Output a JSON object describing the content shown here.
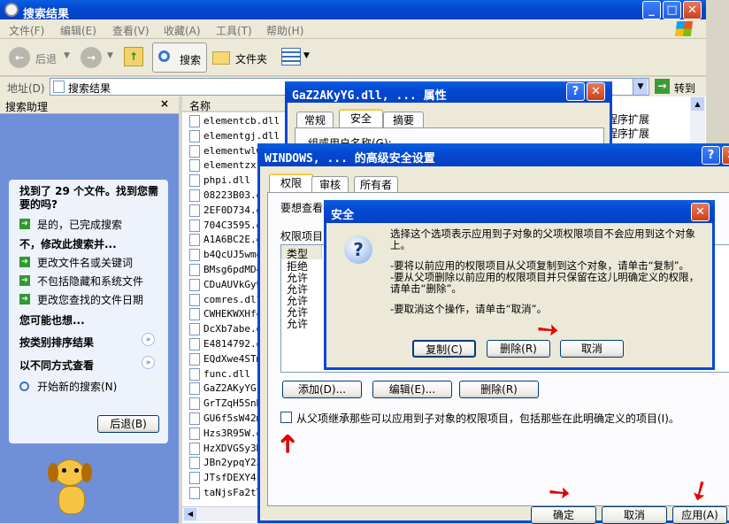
{
  "explorer": {
    "title": "搜索结果",
    "menu": [
      "文件(F)",
      "编辑(E)",
      "查看(V)",
      "收藏(A)",
      "工具(T)",
      "帮助(H)"
    ],
    "toolbar": {
      "back": "后退",
      "search": "搜索",
      "folders": "文件夹"
    },
    "address_label": "地址(D)",
    "address_value": "搜索结果",
    "go": "转到",
    "column_name": "名称",
    "right_items": [
      "程序扩展",
      "程序扩展"
    ],
    "files": [
      "elementcb.dll",
      "elementgj.dll",
      "elementwlw",
      "elementzx.d",
      "phpi.dll",
      "08223B03.d",
      "2EF0D734.d",
      "704C3595.d",
      "A1A6BC2E.d",
      "b4QcUJ5wmq",
      "BMsg6pdMD4",
      "CDuAUVkGy9",
      "comres.dll",
      "CWHEKWXHf4",
      "DcXb7abe.d",
      "E4814792.d",
      "EQdXwe4STm",
      "func.dll",
      "GaZ2AKyYG.d",
      "GrTZqH5SnR",
      "GU6f5sW42m",
      "Hzs3R95W.d",
      "HzXDVGSy3D",
      "JBn2ypqY23",
      "JTsfDEXY4s",
      "taNjsFa2tT"
    ]
  },
  "assistant": {
    "title": "搜索助理",
    "found": "找到了 29 个文件。找到您需要的吗?",
    "yes": "是的，已完成搜索",
    "no_heading": "不，修改此搜索并...",
    "opt1": "更改文件名或关键词",
    "opt2": "不包括隐藏和系统文件",
    "opt3": "更改您查找的文件日期",
    "maybe": "您可能也想...",
    "sort": "按类别排序结果",
    "view": "以不同方式查看",
    "new_search": "开始新的搜索(N)",
    "back": "后退(B)"
  },
  "props": {
    "title": "GaZ2AKyYG.dll, ... 属性",
    "tabs": [
      "常规",
      "安全",
      "摘要"
    ],
    "group_label": "组或用户名称(G):"
  },
  "advanced": {
    "title": "WINDOWS, ... 的高级安全设置",
    "tabs": [
      "权限",
      "审核",
      "所有者"
    ],
    "intro": "要想查看有",
    "perm_label": "权限项目",
    "type_header": "类型",
    "types": [
      "拒绝",
      "允许",
      "允许",
      "允许",
      "允许",
      "允许"
    ],
    "add": "添加(D)...",
    "edit": "编辑(E)...",
    "remove": "删除(R)",
    "inherit": "从父项继承那些可以应用到子对象的权限项目，包括那些在此明确定义的项目(I)。",
    "ok": "确定",
    "cancel": "取消",
    "apply": "应用(A)"
  },
  "security": {
    "title": "安全",
    "line1": "选择这个选项表示应用到子对象的父项权限项目不会应用到这个对象上。",
    "line2": "-要将以前应用的权限项目从父项复制到这个对象，请单击“复制”。",
    "line3": "-要从父项删除以前应用的权限项目并只保留在这儿明确定义的权限，请单击“删除”。",
    "line4": "-要取消这个操作，请单击“取消”。",
    "copy": "复制(C)",
    "remove": "删除(R)",
    "cancel": "取消"
  }
}
